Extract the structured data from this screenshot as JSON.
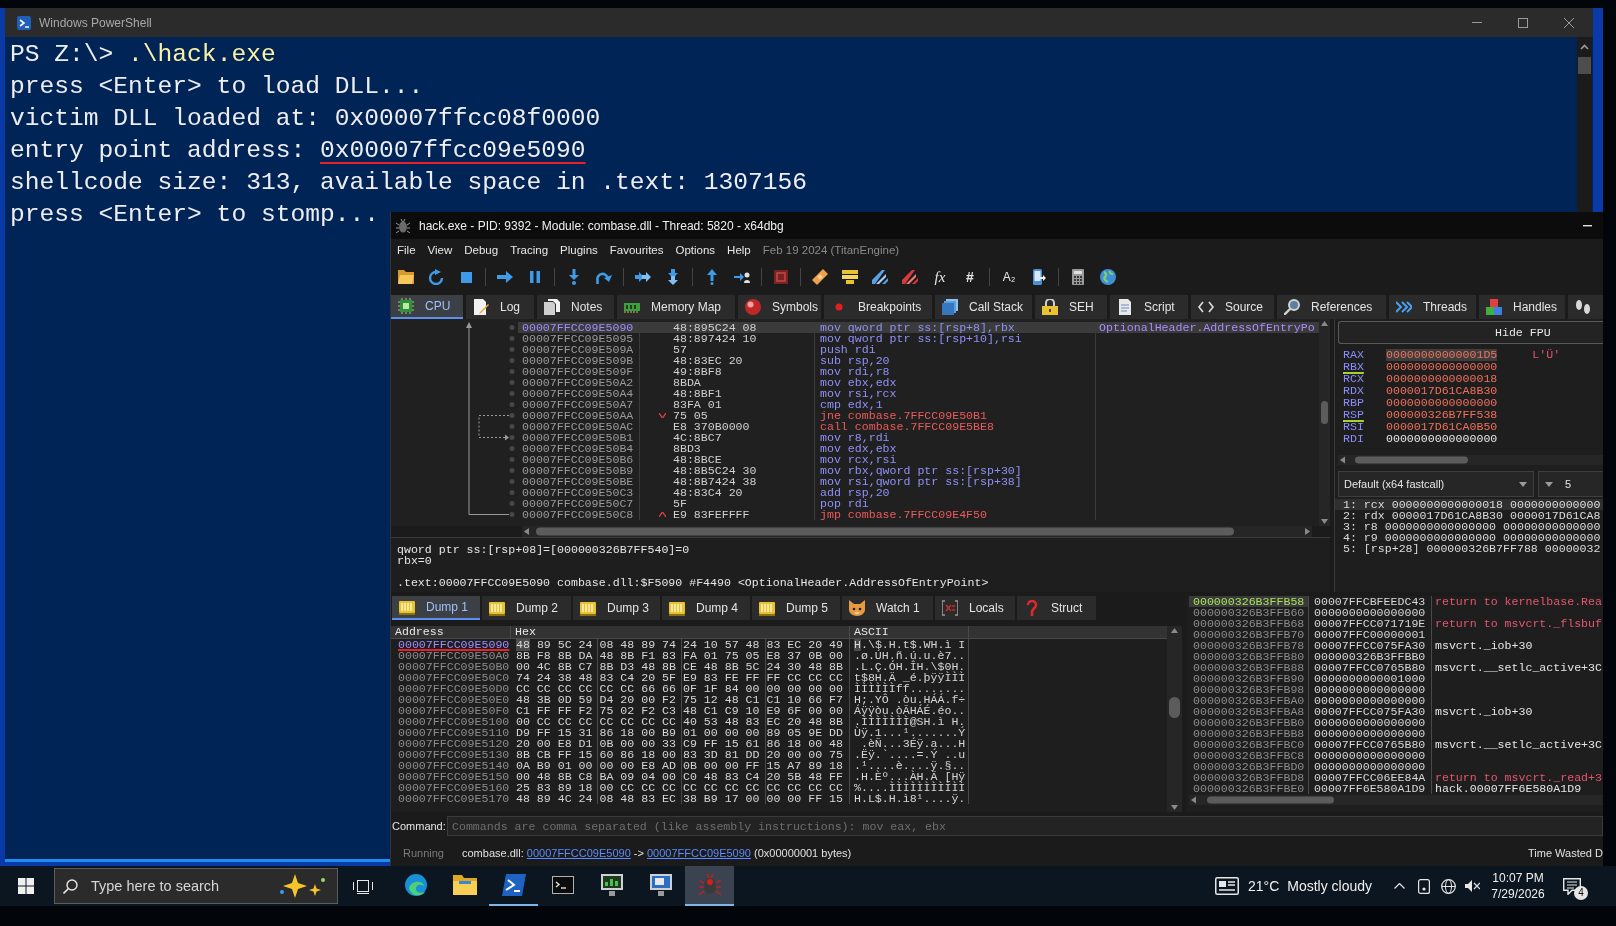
{
  "console": {
    "title": "Windows PowerShell",
    "lines": [
      {
        "segments": [
          {
            "text": "PS Z:\\> ",
            "kind": "plain"
          },
          {
            "text": ".\\hack.exe",
            "kind": "command"
          }
        ]
      },
      {
        "segments": [
          {
            "text": "press <Enter> to load DLL...",
            "kind": "plain"
          }
        ]
      },
      {
        "segments": [
          {
            "text": "victim DLL loaded at: 0x00007ffcc08f0000",
            "kind": "plain"
          }
        ]
      },
      {
        "segments": [
          {
            "text": "entry point address: ",
            "kind": "plain"
          },
          {
            "text": "0x00007ffcc09e5090",
            "kind": "underlined"
          }
        ]
      },
      {
        "segments": [
          {
            "text": "shellcode size: 313, available space in .text: 1307156",
            "kind": "plain"
          }
        ]
      },
      {
        "segments": [
          {
            "text": "press <Enter> to stomp...",
            "kind": "plain"
          }
        ]
      }
    ]
  },
  "debugger": {
    "title": "hack.exe - PID: 9392 - Module: combase.dll - Thread: 5820 - x64dbg",
    "menu": [
      "File",
      "View",
      "Debug",
      "Tracing",
      "Plugins",
      "Favourites",
      "Options",
      "Help"
    ],
    "build_info": "Feb 19 2024 (TitanEngine)",
    "toolbar_text_buttons": [
      "fx",
      "#",
      "A₂"
    ],
    "tabs": [
      {
        "label": "CPU",
        "selected": true
      },
      {
        "label": "Log",
        "selected": false
      },
      {
        "label": "Notes",
        "selected": false
      },
      {
        "label": "Memory Map",
        "selected": false
      },
      {
        "label": "Symbols",
        "selected": false
      },
      {
        "label": "Breakpoints",
        "selected": false
      },
      {
        "label": "Call Stack",
        "selected": false
      },
      {
        "label": "SEH",
        "selected": false
      },
      {
        "label": "Script",
        "selected": false
      },
      {
        "label": "Source",
        "selected": false
      },
      {
        "label": "References",
        "selected": false
      },
      {
        "label": "Threads",
        "selected": false
      },
      {
        "label": "Handles",
        "selected": false
      },
      {
        "selected": false
      }
    ],
    "disassembly": {
      "rows": [
        {
          "address": "00007FFCC09E5090",
          "bytes": "48:895C24 08",
          "instruction": "mov qword ptr ss:[rsp+8],rbx",
          "kind": "plain",
          "selected": true,
          "comment": "OptionalHeader.AddressOfEntryPo"
        },
        {
          "address": "00007FFCC09E5095",
          "bytes": "48:897424 10",
          "instruction": "mov qword ptr ss:[rsp+10],rsi",
          "kind": "plain",
          "selected": false
        },
        {
          "address": "00007FFCC09E509A",
          "bytes": "57",
          "instruction": "push rdi",
          "kind": "plain",
          "selected": false
        },
        {
          "address": "00007FFCC09E509B",
          "bytes": "48:83EC 20",
          "instruction": "sub rsp,20",
          "kind": "plain",
          "selected": false
        },
        {
          "address": "00007FFCC09E509F",
          "bytes": "49:8BF8",
          "instruction": "mov rdi,r8",
          "kind": "plain",
          "selected": false
        },
        {
          "address": "00007FFCC09E50A2",
          "bytes": "8BDA",
          "instruction": "mov ebx,edx",
          "kind": "plain",
          "selected": false
        },
        {
          "address": "00007FFCC09E50A4",
          "bytes": "48:8BF1",
          "instruction": "mov rsi,rcx",
          "kind": "plain",
          "selected": false
        },
        {
          "address": "00007FFCC09E50A7",
          "bytes": "83FA 01",
          "instruction": "cmp edx,1",
          "kind": "plain",
          "selected": false
        },
        {
          "address": "00007FFCC09E50AA",
          "bytes": "75 05",
          "instruction": "jne combase.7FFCC09E50B1",
          "kind": "jump_forward",
          "selected": false
        },
        {
          "address": "00007FFCC09E50AC",
          "bytes": "E8 370B0000",
          "instruction": "call combase.7FFCC09E5BE8",
          "kind": "call",
          "selected": false
        },
        {
          "address": "00007FFCC09E50B1",
          "bytes": "4C:8BC7",
          "instruction": "mov r8,rdi",
          "kind": "plain",
          "selected": false
        },
        {
          "address": "00007FFCC09E50B4",
          "bytes": "8BD3",
          "instruction": "mov edx,ebx",
          "kind": "plain",
          "selected": false
        },
        {
          "address": "00007FFCC09E50B6",
          "bytes": "48:8BCE",
          "instruction": "mov rcx,rsi",
          "kind": "plain",
          "selected": false
        },
        {
          "address": "00007FFCC09E50B9",
          "bytes": "48:8B5C24 30",
          "instruction": "mov rbx,qword ptr ss:[rsp+30]",
          "kind": "plain",
          "selected": false
        },
        {
          "address": "00007FFCC09E50BE",
          "bytes": "48:8B7424 38",
          "instruction": "mov rsi,qword ptr ss:[rsp+38]",
          "kind": "plain",
          "selected": false
        },
        {
          "address": "00007FFCC09E50C3",
          "bytes": "48:83C4 20",
          "instruction": "add rsp,20",
          "kind": "plain",
          "selected": false
        },
        {
          "address": "00007FFCC09E50C7",
          "bytes": "5F",
          "instruction": "pop rdi",
          "kind": "plain",
          "selected": false
        },
        {
          "address": "00007FFCC09E50C8",
          "bytes": "E9 83FEFFFF",
          "instruction": "jmp combase.7FFCC09E4F50",
          "kind": "jump_back",
          "selected": false
        }
      ]
    },
    "info": {
      "lines": [
        "qword ptr ss:[rsp+08]=[000000326B7FF540]=0",
        "rbx=0"
      ],
      "location": ".text:00007FFCC09E5090 combase.dll:$F5090 #F4490 <OptionalHeader.AddressOfEntryPoint>"
    },
    "registers": {
      "toggle": "Hide FPU",
      "rows": [
        {
          "name": "RAX",
          "value": "00000000000001D5",
          "changed": true,
          "used": false,
          "selected": true,
          "char": "L'Ü'"
        },
        {
          "name": "RBX",
          "value": "0000000000000000",
          "changed": true,
          "used": true,
          "selected": false
        },
        {
          "name": "RCX",
          "value": "0000000000000018",
          "changed": true,
          "used": false,
          "selected": false
        },
        {
          "name": "RDX",
          "value": "0000017D61CA8B30",
          "changed": true,
          "used": false,
          "selected": false
        },
        {
          "name": "RBP",
          "value": "0000000000000000",
          "changed": true,
          "used": false,
          "selected": false
        },
        {
          "name": "RSP",
          "value": "000000326B7FF538",
          "changed": true,
          "used": true,
          "selected": false
        },
        {
          "name": "RSI",
          "value": "0000017D61CA0B50",
          "changed": true,
          "used": false,
          "selected": false
        },
        {
          "name": "RDI",
          "value": "0000000000000000",
          "changed": false,
          "used": false,
          "selected": false
        }
      ],
      "calling_convention": "Default (x64 fastcall)",
      "argument_count": "5",
      "arguments": [
        {
          "text": "1: rcx 0000000000000018 0000000000000",
          "selected": true
        },
        {
          "text": "2: rdx 0000017D61CA8B30 0000017D61CA8",
          "selected": false
        },
        {
          "text": "3: r8 0000000000000000 00000000000000",
          "selected": false
        },
        {
          "text": "4: r9 0000000000000000 00000000000000",
          "selected": false
        },
        {
          "text": "5: [rsp+28] 000000326B7FF788 00000032",
          "selected": false
        }
      ]
    },
    "dump": {
      "tabs": [
        {
          "label": "Dump 1",
          "kind": "dump",
          "selected": true
        },
        {
          "label": "Dump 2",
          "kind": "dump",
          "selected": false
        },
        {
          "label": "Dump 3",
          "kind": "dump",
          "selected": false
        },
        {
          "label": "Dump 4",
          "kind": "dump",
          "selected": false
        },
        {
          "label": "Dump 5",
          "kind": "dump",
          "selected": false
        },
        {
          "label": "Watch 1",
          "kind": "watch",
          "selected": false
        },
        {
          "label": "Locals",
          "kind": "locals",
          "selected": false
        },
        {
          "label": "Struct",
          "kind": "struct",
          "selected": false
        }
      ],
      "columns": [
        "Address",
        "Hex",
        "ASCII"
      ],
      "rows": [
        {
          "address": "00007FFCC09E5090",
          "hex": "48 89 5C 24 08 48 89 74 24 10 57 48 83 EC 20 49",
          "ascii": "H.\\$.H.t$.WH.ì I",
          "selected": true,
          "underlined": true
        },
        {
          "address": "00007FFCC09E50A0",
          "hex": "8B F8 8B DA 48 8B F1 83 FA 01 75 05 E8 37 0B 00",
          "ascii": ".ø.ÚH.ñ.ú.u.è7..",
          "selected": false,
          "underlined": false
        },
        {
          "address": "00007FFCC09E50B0",
          "hex": "00 4C 8B C7 8B D3 48 8B CE 48 8B 5C 24 30 48 8B",
          "ascii": ".L.Ç.ÓH.ÎH.\\$0H.",
          "selected": false,
          "underlined": false
        },
        {
          "address": "00007FFCC09E50C0",
          "hex": "74 24 38 48 83 C4 20 5F E9 83 FE FF FF CC CC CC",
          "ascii": "t$8H.Ä _é.þÿÿÌÌÌ",
          "selected": false,
          "underlined": false
        },
        {
          "address": "00007FFCC09E50D0",
          "hex": "CC CC CC CC CC CC 66 66 0F 1F 84 00 00 00 00 00",
          "ascii": "ÌÌÌÌÌÌff........",
          "selected": false,
          "underlined": false
        },
        {
          "address": "00007FFCC09E50E0",
          "hex": "48 3B 0D 59 D4 20 00 F2 75 12 48 C1 C1 10 66 F7",
          "ascii": "H;.YÔ .òu.HÁÁ.f÷",
          "selected": false,
          "underlined": false
        },
        {
          "address": "00007FFCC09E50F0",
          "hex": "C1 FF FF F2 75 02 F2 C3 48 C1 C9 10 E9 6F 00 00",
          "ascii": "Áÿÿòu.òÃHÁÉ.éo..",
          "selected": false,
          "underlined": false
        },
        {
          "address": "00007FFCC09E5100",
          "hex": "00 CC CC CC CC CC CC CC 40 53 48 83 EC 20 48 8B",
          "ascii": ".ÌÌÌÌÌÌÌ@SH.ì H.",
          "selected": false,
          "underlined": false
        },
        {
          "address": "00007FFCC09E5110",
          "hex": "D9 FF 15 31 86 18 00 B9 01 00 00 00 89 05 9E DD",
          "ascii": "Ùÿ.1...¹.......Ý",
          "selected": false,
          "underlined": false
        },
        {
          "address": "00007FFCC09E5120",
          "hex": "20 00 E8 D1 0B 00 00 33 C9 FF 15 61 86 18 00 48",
          "ascii": " .èÑ...3Éÿ.a...H",
          "selected": false,
          "underlined": false
        },
        {
          "address": "00007FFCC09E5130",
          "hex": "8B CB FF 15 60 86 18 00 83 3D 81 DD 20 00 00 75",
          "ascii": ".Ëÿ.`....=.Ý ..u",
          "selected": false,
          "underlined": false
        },
        {
          "address": "00007FFCC09E5140",
          "hex": "0A B9 01 00 00 00 E8 AD 0B 00 00 FF 15 A7 89 18",
          "ascii": ".¹....è....ÿ.§..",
          "selected": false,
          "underlined": false
        },
        {
          "address": "00007FFCC09E5150",
          "hex": "00 48 8B C8 BA 09 04 00 C0 48 83 C4 20 5B 48 FF",
          "ascii": ".H.Èº...ÀH.Ä [Hÿ",
          "selected": false,
          "underlined": false
        },
        {
          "address": "00007FFCC09E5160",
          "hex": "25 83 89 18 00 CC CC CC CC CC CC CC CC CC CC CC",
          "ascii": "%....ÌÌÌÌÌÌÌÌÌÌÌ",
          "selected": false,
          "underlined": false
        },
        {
          "address": "00007FFCC09E5170",
          "hex": "48 89 4C 24 08 48 83 EC 38 B9 17 00 00 00 FF 15",
          "ascii": "H.L$.H.ì8¹....ÿ.",
          "selected": false,
          "underlined": false
        }
      ]
    },
    "stack": {
      "rows": [
        {
          "address": "000000326B3FFB58",
          "value": "00007FFCBFEEDC43",
          "comment": "return to kernelbase.Rea",
          "kind": "return",
          "selected": true
        },
        {
          "address": "000000326B3FFB60",
          "value": "0000000000000000",
          "selected": false
        },
        {
          "address": "000000326B3FFB68",
          "value": "00007FFCC071719E",
          "comment": "return to msvcrt._flsbuf",
          "kind": "return",
          "selected": false
        },
        {
          "address": "000000326B3FFB70",
          "value": "00007FFC00000001",
          "selected": false
        },
        {
          "address": "000000326B3FFB78",
          "value": "00007FFCC075FA30",
          "comment": "msvcrt._iob+30",
          "kind": "symbol",
          "selected": false
        },
        {
          "address": "000000326B3FFB80",
          "value": "000000326B3FFBB0",
          "selected": false
        },
        {
          "address": "000000326B3FFB88",
          "value": "00007FFCC0765B80",
          "comment": "msvcrt.__setlc_active+3C",
          "kind": "symbol",
          "selected": false
        },
        {
          "address": "000000326B3FFB90",
          "value": "0000000000001000",
          "selected": false
        },
        {
          "address": "000000326B3FFB98",
          "value": "0000000000000000",
          "selected": false
        },
        {
          "address": "000000326B3FFBA0",
          "value": "0000000000000000",
          "selected": false
        },
        {
          "address": "000000326B3FFBA8",
          "value": "00007FFCC075FA30",
          "comment": "msvcrt._iob+30",
          "kind": "symbol",
          "selected": false
        },
        {
          "address": "000000326B3FFBB0",
          "value": "0000000000000000",
          "selected": false
        },
        {
          "address": "000000326B3FFBB8",
          "value": "0000000000000000",
          "selected": false
        },
        {
          "address": "000000326B3FFBC0",
          "value": "00007FFCC0765B80",
          "comment": "msvcrt.__setlc_active+3C",
          "kind": "symbol",
          "selected": false
        },
        {
          "address": "000000326B3FFBC8",
          "value": "0000000000000000",
          "selected": false
        },
        {
          "address": "000000326B3FFBD0",
          "value": "0000000000000000",
          "selected": false
        },
        {
          "address": "000000326B3FFBD8",
          "value": "00007FFCC06EE84A",
          "comment": "return to msvcrt._read+3",
          "kind": "return",
          "selected": false
        },
        {
          "address": "000000326B3FFBE0",
          "value": "00007FF6E580A1D9",
          "comment": "hack.00007FF6E580A1D9",
          "kind": "symbol",
          "selected": false
        }
      ]
    },
    "command": {
      "label": "Command:",
      "placeholder": "Commands are comma separated (like assembly instructions): mov eax, ebx"
    },
    "status": {
      "state": "Running",
      "prefix": "combase.dll: ",
      "from": "00007FFCC09E5090",
      "separator": " -> ",
      "to": "00007FFCC09E5090",
      "suffix": " (0x00000001 bytes)",
      "timer": "Time Wasted D"
    }
  },
  "taskbar": {
    "search_placeholder": "Type here to search",
    "apps": [
      {
        "running": false,
        "focused": false
      },
      {
        "running": false,
        "focused": false
      },
      {
        "running": true,
        "focused": false
      },
      {
        "running": false,
        "focused": false
      },
      {
        "running": false,
        "focused": false
      },
      {
        "running": false,
        "focused": false
      },
      {
        "running": true,
        "focused": true
      }
    ],
    "weather": {
      "temperature": "21°C",
      "condition": "Mostly cloudy"
    },
    "time": "10:07 PM",
    "date": "7/29/2026",
    "notifications": "4"
  }
}
